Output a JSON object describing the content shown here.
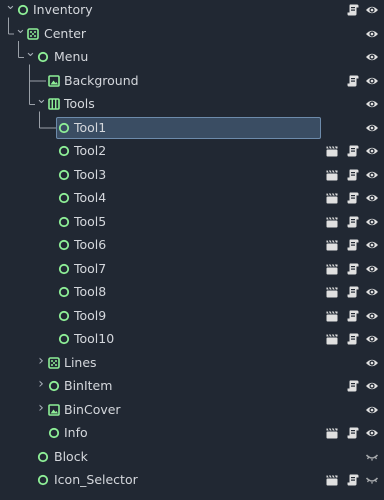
{
  "tree": {
    "nodes": [
      {
        "label": "Inventory",
        "type": "control",
        "depth": 0,
        "arrow": "expanded",
        "script": true,
        "scene": false,
        "visibility": "eye"
      },
      {
        "label": "Center",
        "type": "center",
        "depth": 1,
        "arrow": "expanded",
        "script": false,
        "scene": false,
        "visibility": "eye"
      },
      {
        "label": "Menu",
        "type": "control",
        "depth": 2,
        "arrow": "expanded",
        "script": false,
        "scene": false,
        "visibility": "eye"
      },
      {
        "label": "Background",
        "type": "texture",
        "depth": 3,
        "arrow": "none",
        "script": true,
        "scene": false,
        "visibility": "eye"
      },
      {
        "label": "Tools",
        "type": "grid",
        "depth": 3,
        "arrow": "expanded",
        "script": false,
        "scene": false,
        "visibility": "eye"
      },
      {
        "label": "Tool1",
        "type": "control",
        "depth": 4,
        "arrow": "none",
        "script": false,
        "scene": false,
        "visibility": "eye",
        "selected": true
      },
      {
        "label": "Tool2",
        "type": "control",
        "depth": 4,
        "arrow": "none",
        "script": true,
        "scene": true,
        "visibility": "eye"
      },
      {
        "label": "Tool3",
        "type": "control",
        "depth": 4,
        "arrow": "none",
        "script": true,
        "scene": true,
        "visibility": "eye"
      },
      {
        "label": "Tool4",
        "type": "control",
        "depth": 4,
        "arrow": "none",
        "script": true,
        "scene": true,
        "visibility": "eye"
      },
      {
        "label": "Tool5",
        "type": "control",
        "depth": 4,
        "arrow": "none",
        "script": true,
        "scene": true,
        "visibility": "eye"
      },
      {
        "label": "Tool6",
        "type": "control",
        "depth": 4,
        "arrow": "none",
        "script": true,
        "scene": true,
        "visibility": "eye"
      },
      {
        "label": "Tool7",
        "type": "control",
        "depth": 4,
        "arrow": "none",
        "script": true,
        "scene": true,
        "visibility": "eye"
      },
      {
        "label": "Tool8",
        "type": "control",
        "depth": 4,
        "arrow": "none",
        "script": true,
        "scene": true,
        "visibility": "eye"
      },
      {
        "label": "Tool9",
        "type": "control",
        "depth": 4,
        "arrow": "none",
        "script": true,
        "scene": true,
        "visibility": "eye"
      },
      {
        "label": "Tool10",
        "type": "control",
        "depth": 4,
        "arrow": "none",
        "script": true,
        "scene": true,
        "visibility": "eye"
      },
      {
        "label": "Lines",
        "type": "center",
        "depth": 3,
        "arrow": "collapsed",
        "script": false,
        "scene": false,
        "visibility": "eye"
      },
      {
        "label": "BinItem",
        "type": "control",
        "depth": 3,
        "arrow": "collapsed",
        "script": true,
        "scene": false,
        "visibility": "eye"
      },
      {
        "label": "BinCover",
        "type": "texture",
        "depth": 3,
        "arrow": "collapsed",
        "script": false,
        "scene": false,
        "visibility": "eye"
      },
      {
        "label": "Info",
        "type": "control",
        "depth": 3,
        "arrow": "none",
        "script": true,
        "scene": true,
        "visibility": "eye"
      },
      {
        "label": "Block",
        "type": "control",
        "depth": 2,
        "arrow": "none",
        "script": false,
        "scene": false,
        "visibility": "hidden"
      },
      {
        "label": "Icon_Selector",
        "type": "control",
        "depth": 2,
        "arrow": "none",
        "script": true,
        "scene": true,
        "visibility": "hidden"
      }
    ]
  },
  "colors": {
    "background": "#212833",
    "node_green": "#8eef97",
    "icon_white": "#e0e0e0",
    "selection_fill": "#3a4d63",
    "selection_border": "#6d8bab",
    "guide": "#9aa0a8"
  }
}
